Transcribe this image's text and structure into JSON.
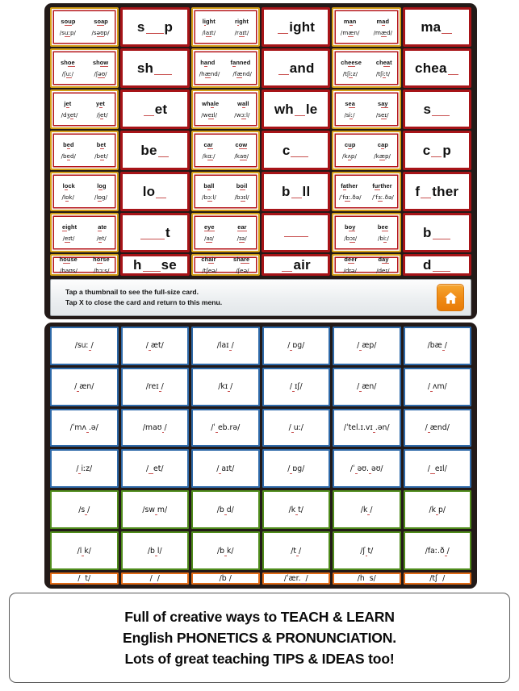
{
  "instruction_bar": {
    "line1": "Tap a thumbnail to see the full-size card.",
    "line2": "Tap X to close the card and return to this menu.",
    "home_icon": "home-icon"
  },
  "caption": {
    "line1": "Full of creative ways to TEACH & LEARN",
    "line2": "English PHONETICS & PRONUNCIATION.",
    "line3": "Lots of great teaching TIPS & IDEAS too!"
  },
  "colors": {
    "card_gold": "#d4a017",
    "card_red": "#b5151a",
    "card_red_dark": "#a71418",
    "underline_red": "#c8504f",
    "grid_blue": "#2e69a8",
    "grid_green": "#4f8b1b",
    "grid_orange": "#df6a16",
    "home_orange": "#ef8b16",
    "device_frame": "#231a18"
  },
  "top_grid": {
    "rows": 6,
    "cols": 6,
    "cards": [
      {
        "type": "dual",
        "words": [
          {
            "text": "soup",
            "underline": "ou"
          },
          {
            "text": "soap",
            "underline": "oa"
          }
        ],
        "phonetics": [
          {
            "text": "/suːp/",
            "underline": "uː"
          },
          {
            "text": "/səʊp/",
            "underline": "əʊ"
          }
        ]
      },
      {
        "type": "single",
        "pre": "s",
        "gap": "g2",
        "post": "p"
      },
      {
        "type": "dual",
        "words": [
          {
            "text": "light",
            "underline": "i"
          },
          {
            "text": "right",
            "underline": "i"
          }
        ],
        "phonetics": [
          {
            "text": "/laɪt/",
            "underline": "aɪ"
          },
          {
            "text": "/raɪt/",
            "underline": "aɪ"
          }
        ]
      },
      {
        "type": "single",
        "pre": "",
        "gap": "g1",
        "post": "ight"
      },
      {
        "type": "dual",
        "words": [
          {
            "text": "man",
            "underline": "a"
          },
          {
            "text": "mad",
            "underline": "a"
          }
        ],
        "phonetics": [
          {
            "text": "/mæn/",
            "underline": "æ"
          },
          {
            "text": "/mæd/",
            "underline": "æ"
          }
        ]
      },
      {
        "type": "single",
        "pre": "ma",
        "gap": "g1",
        "post": ""
      },
      {
        "type": "dual",
        "words": [
          {
            "text": "shoe",
            "underline": "oe"
          },
          {
            "text": "show",
            "underline": "ow"
          }
        ],
        "phonetics": [
          {
            "text": "/ʃuː/",
            "underline": "uː"
          },
          {
            "text": "/ʃəʊ/",
            "underline": "əʊ"
          }
        ]
      },
      {
        "type": "single",
        "pre": "sh",
        "gap": "g2",
        "post": ""
      },
      {
        "type": "dual",
        "words": [
          {
            "text": "hand",
            "underline": "a"
          },
          {
            "text": "fanned",
            "underline": "a"
          }
        ],
        "phonetics": [
          {
            "text": "/hænd/",
            "underline": "æ"
          },
          {
            "text": "/fænd/",
            "underline": "æ"
          }
        ]
      },
      {
        "type": "single",
        "pre": "",
        "gap": "g1",
        "post": "and"
      },
      {
        "type": "dual",
        "words": [
          {
            "text": "cheese",
            "underline": "ee"
          },
          {
            "text": "cheat",
            "underline": "ea"
          }
        ],
        "phonetics": [
          {
            "text": "/tʃiːz/",
            "underline": "iː"
          },
          {
            "text": "/tʃiːt/",
            "underline": "iː"
          }
        ]
      },
      {
        "type": "single",
        "pre": "chea",
        "gap": "g1",
        "post": ""
      },
      {
        "type": "dual",
        "words": [
          {
            "text": "jet",
            "underline": "e"
          },
          {
            "text": "yet",
            "underline": "e"
          }
        ],
        "phonetics": [
          {
            "text": "/dʒet/",
            "underline": "e"
          },
          {
            "text": "/jet/",
            "underline": "e"
          }
        ]
      },
      {
        "type": "single",
        "pre": "",
        "gap": "g1",
        "post": "et"
      },
      {
        "type": "dual",
        "words": [
          {
            "text": "whale",
            "underline": "a"
          },
          {
            "text": "wall",
            "underline": "a"
          }
        ],
        "phonetics": [
          {
            "text": "/weɪl/",
            "underline": "eɪ"
          },
          {
            "text": "/wɔːl/",
            "underline": "ɔː"
          }
        ]
      },
      {
        "type": "single",
        "pre": "wh",
        "gap": "g1",
        "post": "le"
      },
      {
        "type": "dual",
        "words": [
          {
            "text": "sea",
            "underline": "ea"
          },
          {
            "text": "say",
            "underline": "ay"
          }
        ],
        "phonetics": [
          {
            "text": "/siː/",
            "underline": "iː"
          },
          {
            "text": "/seɪ/",
            "underline": "eɪ"
          }
        ]
      },
      {
        "type": "single",
        "pre": "s",
        "gap": "g2",
        "post": ""
      },
      {
        "type": "dual",
        "words": [
          {
            "text": "bed",
            "underline": "e"
          },
          {
            "text": "bet",
            "underline": "e"
          }
        ],
        "phonetics": [
          {
            "text": "/bed/",
            "underline": "e"
          },
          {
            "text": "/bet/",
            "underline": "e"
          }
        ]
      },
      {
        "type": "single",
        "pre": "be",
        "gap": "g1",
        "post": ""
      },
      {
        "type": "dual",
        "words": [
          {
            "text": "car",
            "underline": "ar"
          },
          {
            "text": "cow",
            "underline": "ow"
          }
        ],
        "phonetics": [
          {
            "text": "/kɑː/",
            "underline": "ɑː"
          },
          {
            "text": "/kaʊ/",
            "underline": "aʊ"
          }
        ]
      },
      {
        "type": "single",
        "pre": "c",
        "gap": "g2",
        "post": ""
      },
      {
        "type": "dual",
        "words": [
          {
            "text": "cup",
            "underline": "u"
          },
          {
            "text": "cap",
            "underline": "a"
          }
        ],
        "phonetics": [
          {
            "text": "/kʌp/",
            "underline": "ʌ"
          },
          {
            "text": "/kæp/",
            "underline": "æ"
          }
        ]
      },
      {
        "type": "single",
        "pre": "c",
        "gap": "g1",
        "post": "p"
      },
      {
        "type": "dual",
        "words": [
          {
            "text": "lock",
            "underline": "o"
          },
          {
            "text": "log",
            "underline": "o"
          }
        ],
        "phonetics": [
          {
            "text": "/lɒk/",
            "underline": "ɒ"
          },
          {
            "text": "/lɒg/",
            "underline": "ɒ"
          }
        ]
      },
      {
        "type": "single",
        "pre": "lo",
        "gap": "g1",
        "post": ""
      },
      {
        "type": "dual",
        "words": [
          {
            "text": "ball",
            "underline": "a"
          },
          {
            "text": "boil",
            "underline": "oi"
          }
        ],
        "phonetics": [
          {
            "text": "/bɔːl/",
            "underline": "ɔː"
          },
          {
            "text": "/bɔɪl/",
            "underline": "ɔɪ"
          }
        ]
      },
      {
        "type": "single",
        "pre": "b",
        "gap": "g1",
        "post": "ll"
      },
      {
        "type": "dual",
        "words": [
          {
            "text": "father",
            "underline": "a"
          },
          {
            "text": "further",
            "underline": "ur"
          }
        ],
        "phonetics": [
          {
            "text": "/ˈfɑː.ðə/",
            "underline": "ɑː"
          },
          {
            "text": "/ˈfɜː.ðə/",
            "underline": "ɜː"
          }
        ]
      },
      {
        "type": "single",
        "pre": "f",
        "gap": "g1",
        "post": "ther"
      },
      {
        "type": "dual",
        "words": [
          {
            "text": "eight",
            "underline": "ei"
          },
          {
            "text": "ate",
            "underline": "a"
          }
        ],
        "phonetics": [
          {
            "text": "/eɪt/",
            "underline": "eɪ"
          },
          {
            "text": "/et/",
            "underline": "e"
          }
        ]
      },
      {
        "type": "single",
        "pre": "",
        "gap": "g3",
        "post": "t"
      },
      {
        "type": "dual",
        "words": [
          {
            "text": "eye",
            "underline": "eye"
          },
          {
            "text": "ear",
            "underline": "ear"
          }
        ],
        "phonetics": [
          {
            "text": "/aɪ/",
            "underline": "aɪ"
          },
          {
            "text": "/ɪə/",
            "underline": "ɪə"
          }
        ]
      },
      {
        "type": "single",
        "pre": "",
        "gap": "g3",
        "post": ""
      },
      {
        "type": "dual",
        "words": [
          {
            "text": "boy",
            "underline": "oy"
          },
          {
            "text": "bee",
            "underline": "ee"
          }
        ],
        "phonetics": [
          {
            "text": "/bɔɪ/",
            "underline": "ɔɪ"
          },
          {
            "text": "/biː/",
            "underline": "iː"
          }
        ]
      },
      {
        "type": "single",
        "pre": "b",
        "gap": "g2",
        "post": ""
      },
      {
        "type": "dual",
        "words": [
          {
            "text": "house",
            "underline": "ou"
          },
          {
            "text": "horse",
            "underline": "or"
          }
        ],
        "phonetics": [
          {
            "text": "/haʊs/",
            "underline": "aʊ"
          },
          {
            "text": "/hɔːs/",
            "underline": "ɔː"
          }
        ]
      },
      {
        "type": "single",
        "pre": "h",
        "gap": "g2",
        "post": "se"
      },
      {
        "type": "dual",
        "words": [
          {
            "text": "chair",
            "underline": "ai"
          },
          {
            "text": "share",
            "underline": "are"
          }
        ],
        "phonetics": [
          {
            "text": "/tʃeə/",
            "underline": "eə"
          },
          {
            "text": "/ʃeə/",
            "underline": "eə"
          }
        ]
      },
      {
        "type": "single",
        "pre": "",
        "gap": "g1",
        "post": "air"
      },
      {
        "type": "dual",
        "words": [
          {
            "text": "deer",
            "underline": "ee"
          },
          {
            "text": "day",
            "underline": "ay"
          }
        ],
        "phonetics": [
          {
            "text": "/dɪə/",
            "underline": "ɪə"
          },
          {
            "text": "/deɪ/",
            "underline": "eɪ"
          }
        ]
      },
      {
        "type": "single",
        "pre": "d",
        "gap": "g2",
        "post": ""
      }
    ]
  },
  "bottom_grid": {
    "rows": 6,
    "cols": 6,
    "cells": [
      {
        "color": "blue",
        "pre": "/suː",
        "gap": 1,
        "post": "/"
      },
      {
        "color": "blue",
        "pre": "/",
        "gap": 1,
        "post": "æt/"
      },
      {
        "color": "blue",
        "pre": "/laɪ",
        "gap": 1,
        "post": "/"
      },
      {
        "color": "blue",
        "pre": "/",
        "gap": 1,
        "post": "ɒg/"
      },
      {
        "color": "blue",
        "pre": "/",
        "gap": 1,
        "post": "æp/"
      },
      {
        "color": "blue",
        "pre": "/bæ",
        "gap": 1,
        "post": "/"
      },
      {
        "color": "blue",
        "pre": "/",
        "gap": 1,
        "post": "æn/"
      },
      {
        "color": "blue",
        "pre": "/reɪ",
        "gap": 1,
        "post": "/"
      },
      {
        "color": "blue",
        "pre": "/kɪ",
        "gap": 1,
        "post": "/"
      },
      {
        "color": "blue",
        "pre": "/",
        "gap": 1,
        "post": "ɪʃ/"
      },
      {
        "color": "blue",
        "pre": "/",
        "gap": 1,
        "post": "æn/"
      },
      {
        "color": "blue",
        "pre": "/",
        "gap": 1,
        "post": "ʌm/"
      },
      {
        "color": "blue",
        "pre": "/ˈmʌ",
        "gap": 1,
        "post": ".ə/"
      },
      {
        "color": "blue",
        "pre": "/maʊ",
        "gap": 1,
        "post": "/"
      },
      {
        "color": "blue",
        "pre": "/ˈ",
        "gap": 1,
        "post": "eb.rə/"
      },
      {
        "color": "blue",
        "pre": "/",
        "gap": 1,
        "post": "uː/"
      },
      {
        "color": "blue",
        "pre": "/ˈtel.ɪ.vɪ",
        "gap": 1,
        "post": ".ən/"
      },
      {
        "color": "blue",
        "pre": "/",
        "gap": 1,
        "post": "ænd/"
      },
      {
        "color": "blue",
        "pre": "/",
        "gap": 1,
        "post": "iːz/"
      },
      {
        "color": "blue",
        "pre": "/",
        "gap": 2,
        "post": "et/"
      },
      {
        "color": "blue",
        "pre": "/",
        "gap": 1,
        "post": "aɪt/"
      },
      {
        "color": "blue",
        "pre": "/",
        "gap": 1,
        "post": "ɒg/"
      },
      {
        "color": "blue",
        "pre": "/ˈ",
        "gap": 1,
        "post": "əʊ.",
        "post2": "əʊ/"
      },
      {
        "color": "blue",
        "pre": "/",
        "gap": 2,
        "post": "eɪl/"
      },
      {
        "color": "green",
        "pre": "/s",
        "gap": 1,
        "post": "/"
      },
      {
        "color": "green",
        "pre": "/sw",
        "gap": 1,
        "post": "m/"
      },
      {
        "color": "green",
        "pre": "/b",
        "gap": 1,
        "post": "d/"
      },
      {
        "color": "green",
        "pre": "/k",
        "gap": 1,
        "post": "t/"
      },
      {
        "color": "green",
        "pre": "/k",
        "gap": 1,
        "post": "/"
      },
      {
        "color": "green",
        "pre": "/k",
        "gap": 1,
        "post": "p/"
      },
      {
        "color": "green",
        "pre": "/l",
        "gap": 1,
        "post": "k/"
      },
      {
        "color": "green",
        "pre": "/b",
        "gap": 1,
        "post": "l/"
      },
      {
        "color": "green",
        "pre": "/b",
        "gap": 1,
        "post": "k/"
      },
      {
        "color": "green",
        "pre": "/t",
        "gap": 1,
        "post": "/"
      },
      {
        "color": "green",
        "pre": "/ʃ",
        "gap": 1,
        "post": "t/"
      },
      {
        "color": "green",
        "pre": "/faː.ð",
        "gap": 1,
        "post": "/"
      },
      {
        "color": "orange",
        "pre": "/",
        "gap": 2,
        "post": "t/"
      },
      {
        "color": "orange",
        "pre": "/",
        "gap": 2,
        "post": "/"
      },
      {
        "color": "orange",
        "pre": "/b",
        "gap": 1,
        "post": "/"
      },
      {
        "color": "orange",
        "pre": "/ˈær.",
        "gap": 2,
        "post": "/"
      },
      {
        "color": "orange",
        "pre": "/h",
        "gap": 2,
        "post": "s/"
      },
      {
        "color": "orange",
        "pre": "/tʃ",
        "gap": 2,
        "post": "/"
      }
    ]
  }
}
